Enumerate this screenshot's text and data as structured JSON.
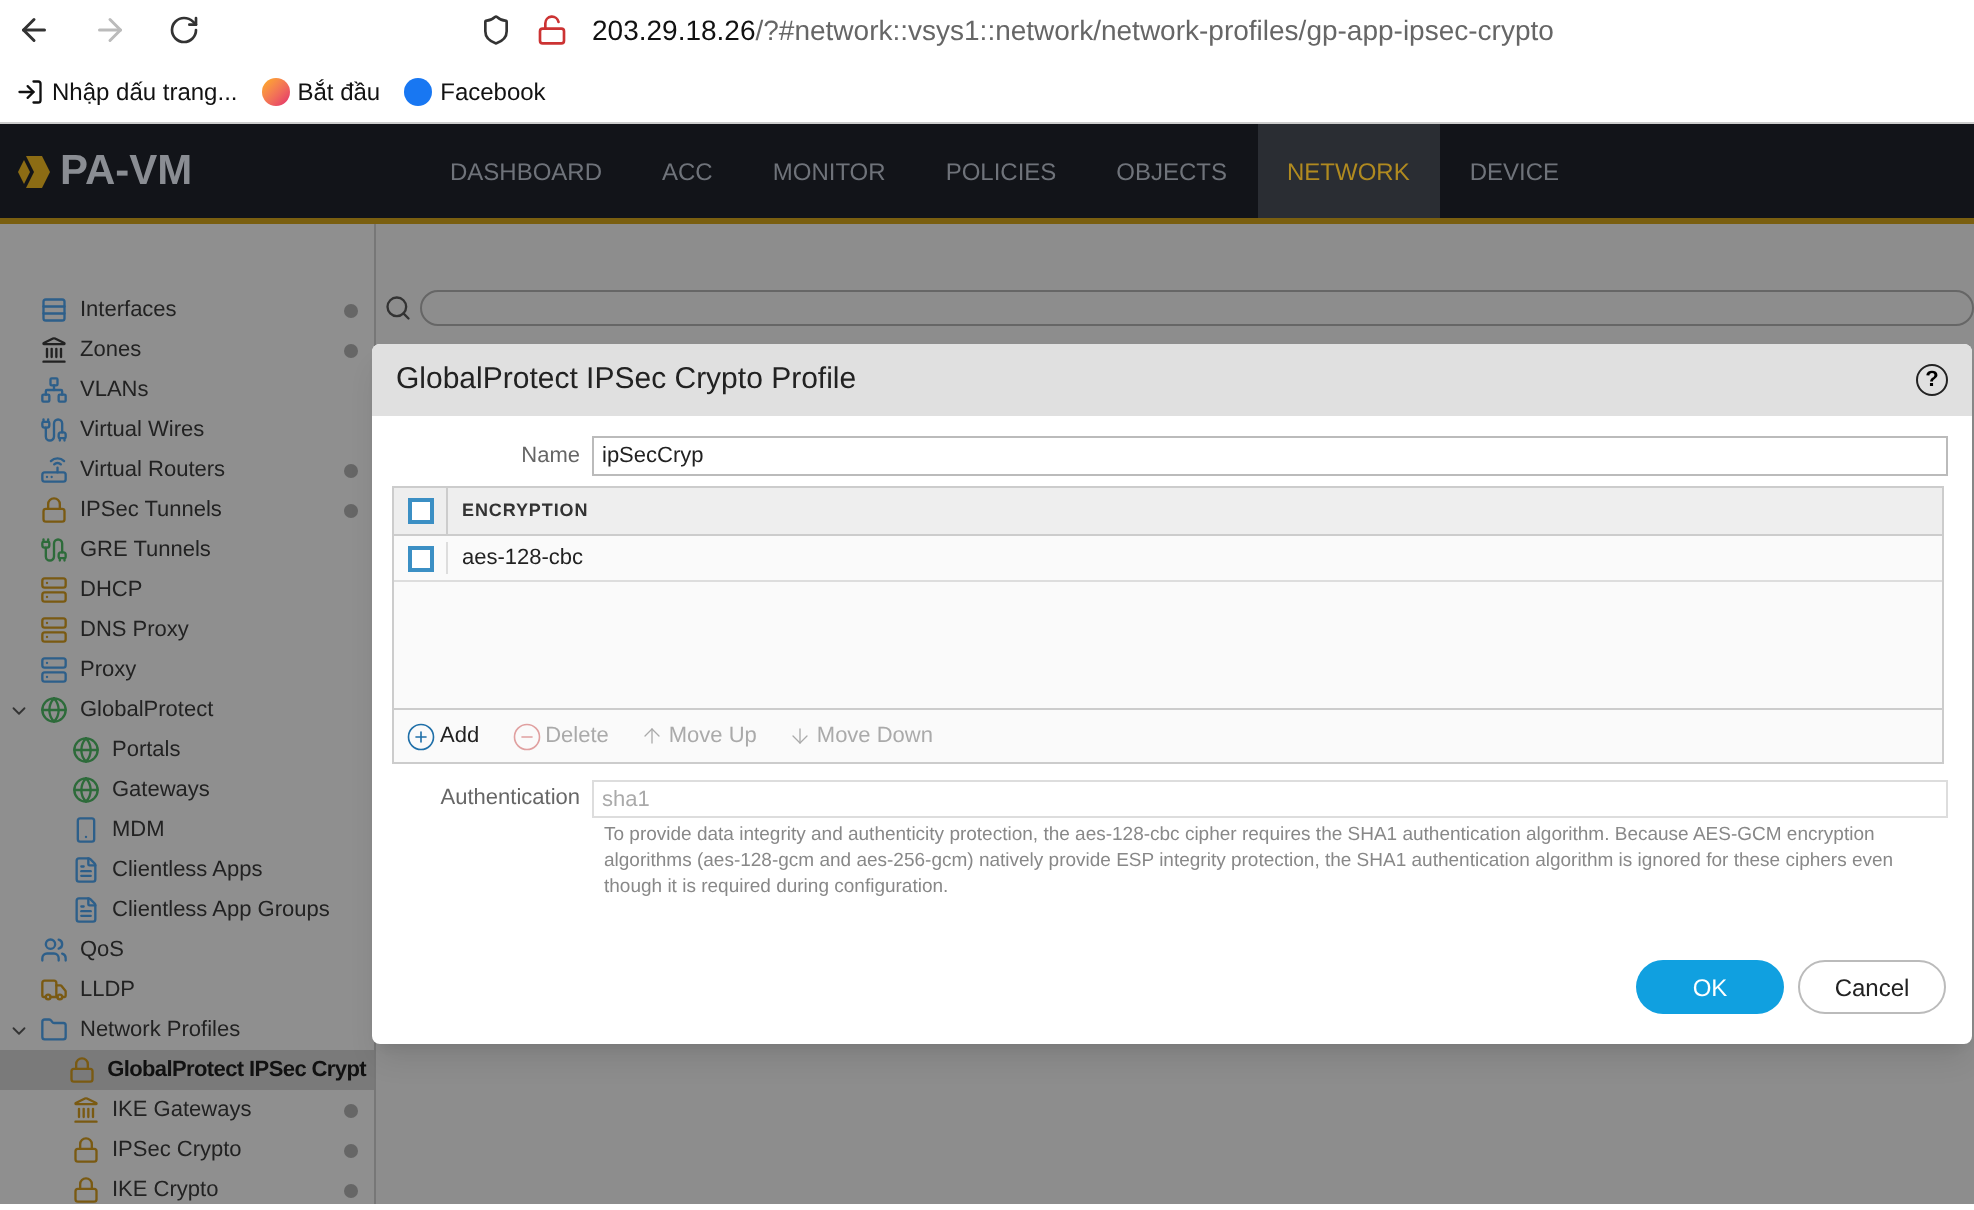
{
  "browser": {
    "url_host": "203.29.18.26",
    "url_path": "/?#network::vsys1::network/network-profiles/gp-app-ipsec-crypto",
    "bookmarks": [
      {
        "kind": "import",
        "label": "Nhập dấu trang..."
      },
      {
        "kind": "firefox",
        "label": "Bắt đầu"
      },
      {
        "kind": "facebook",
        "label": "Facebook"
      }
    ]
  },
  "app": {
    "logo": "PA-VM",
    "tabs": [
      {
        "label": "DASHBOARD",
        "selected": false
      },
      {
        "label": "ACC",
        "selected": false
      },
      {
        "label": "MONITOR",
        "selected": false
      },
      {
        "label": "POLICIES",
        "selected": false
      },
      {
        "label": "OBJECTS",
        "selected": false
      },
      {
        "label": "NETWORK",
        "selected": true
      },
      {
        "label": "DEVICE",
        "selected": false
      }
    ]
  },
  "sidebar": {
    "items": [
      {
        "label": "Interfaces",
        "dot": true,
        "selected": false
      },
      {
        "label": "Zones",
        "dot": true,
        "selected": false
      },
      {
        "label": "VLANs",
        "dot": false,
        "selected": false
      },
      {
        "label": "Virtual Wires",
        "dot": false,
        "selected": false
      },
      {
        "label": "Virtual Routers",
        "dot": true,
        "selected": false
      },
      {
        "label": "IPSec Tunnels",
        "dot": true,
        "selected": false
      },
      {
        "label": "GRE Tunnels",
        "dot": false,
        "selected": false
      },
      {
        "label": "DHCP",
        "dot": false,
        "selected": false
      },
      {
        "label": "DNS Proxy",
        "dot": false,
        "selected": false
      },
      {
        "label": "Proxy",
        "dot": false,
        "selected": false
      },
      {
        "label": "GlobalProtect",
        "dot": false,
        "selected": false,
        "expanded": true,
        "children": [
          {
            "label": "Portals",
            "dot": false,
            "selected": false
          },
          {
            "label": "Gateways",
            "dot": false,
            "selected": false
          },
          {
            "label": "MDM",
            "dot": false,
            "selected": false
          },
          {
            "label": "Clientless Apps",
            "dot": false,
            "selected": false
          },
          {
            "label": "Clientless App Groups",
            "dot": false,
            "selected": false
          }
        ]
      },
      {
        "label": "QoS",
        "dot": false,
        "selected": false
      },
      {
        "label": "LLDP",
        "dot": false,
        "selected": false
      },
      {
        "label": "Network Profiles",
        "dot": false,
        "selected": false,
        "expanded": true,
        "children": [
          {
            "label": "GlobalProtect IPSec Crypt",
            "dot": false,
            "selected": true
          },
          {
            "label": "IKE Gateways",
            "dot": true,
            "selected": false
          },
          {
            "label": "IPSec Crypto",
            "dot": true,
            "selected": false
          },
          {
            "label": "IKE Crypto",
            "dot": true,
            "selected": false
          }
        ]
      }
    ]
  },
  "dialog": {
    "title": "GlobalProtect IPSec Crypto Profile",
    "help": "?",
    "name_label": "Name",
    "name_value": "ipSecCryp",
    "table": {
      "header_checked": false,
      "columns": [
        "ENCRYPTION"
      ],
      "rows": [
        {
          "value": "aes-128-cbc",
          "checked": false
        }
      ]
    },
    "actions": [
      {
        "label": "Add",
        "disabled": false
      },
      {
        "label": "Delete",
        "disabled": true
      },
      {
        "label": "Move Up",
        "disabled": true
      },
      {
        "label": "Move Down",
        "disabled": true
      }
    ],
    "auth_label": "Authentication",
    "auth_value": "sha1",
    "auth_help": "To provide data integrity and authenticity protection, the aes-128-cbc cipher requires the SHA1 authentication algorithm. Because AES-GCM encryption algorithms (aes-128-gcm and aes-256-gcm) natively provide ESP integrity protection, the SHA1 authentication algorithm is ignored for these ciphers even though it is required during configuration.",
    "ok": "OK",
    "cancel": "Cancel"
  }
}
